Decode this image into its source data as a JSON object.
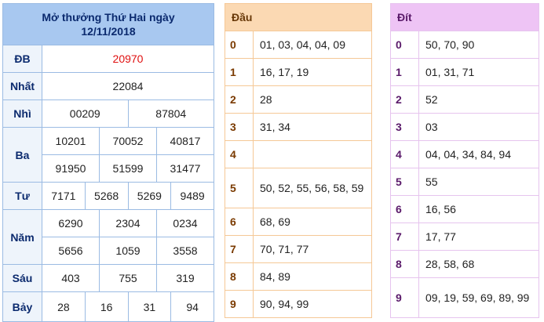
{
  "results": {
    "title_line1": "Mở thưởng Thứ Hai ngày",
    "title_line2": "12/11/2018",
    "db": {
      "label": "ĐB",
      "values": [
        "20970"
      ]
    },
    "nhat": {
      "label": "Nhất",
      "values": [
        "22084"
      ]
    },
    "nhi": {
      "label": "Nhì",
      "values": [
        "00209",
        "87804"
      ]
    },
    "ba": {
      "label": "Ba",
      "values": [
        "10201",
        "70052",
        "40817",
        "91950",
        "51599",
        "31477"
      ]
    },
    "tu": {
      "label": "Tư",
      "values": [
        "7171",
        "5268",
        "5269",
        "9489"
      ]
    },
    "nam": {
      "label": "Năm",
      "values": [
        "6290",
        "2304",
        "0234",
        "5656",
        "1059",
        "3558"
      ]
    },
    "sau": {
      "label": "Sáu",
      "values": [
        "403",
        "755",
        "319"
      ]
    },
    "bay": {
      "label": "Bảy",
      "values": [
        "28",
        "16",
        "31",
        "94"
      ]
    }
  },
  "dau": {
    "header": "Đầu",
    "rows": [
      {
        "num": "0",
        "vals": "01, 03, 04, 04, 09"
      },
      {
        "num": "1",
        "vals": "16, 17, 19"
      },
      {
        "num": "2",
        "vals": "28"
      },
      {
        "num": "3",
        "vals": "31, 34"
      },
      {
        "num": "4",
        "vals": ""
      },
      {
        "num": "5",
        "vals": "50, 52, 55, 56, 58, 59"
      },
      {
        "num": "6",
        "vals": "68, 69"
      },
      {
        "num": "7",
        "vals": "70, 71, 77"
      },
      {
        "num": "8",
        "vals": "84, 89"
      },
      {
        "num": "9",
        "vals": "90, 94, 99"
      }
    ]
  },
  "dit": {
    "header": "Đít",
    "rows": [
      {
        "num": "0",
        "vals": "50, 70, 90"
      },
      {
        "num": "1",
        "vals": "01, 31, 71"
      },
      {
        "num": "2",
        "vals": "52"
      },
      {
        "num": "3",
        "vals": "03"
      },
      {
        "num": "4",
        "vals": "04, 04, 34, 84, 94"
      },
      {
        "num": "5",
        "vals": "55"
      },
      {
        "num": "6",
        "vals": "16, 56"
      },
      {
        "num": "7",
        "vals": "17, 77"
      },
      {
        "num": "8",
        "vals": "28, 58, 68"
      },
      {
        "num": "9",
        "vals": "09, 19, 59, 69, 89, 99"
      }
    ]
  }
}
